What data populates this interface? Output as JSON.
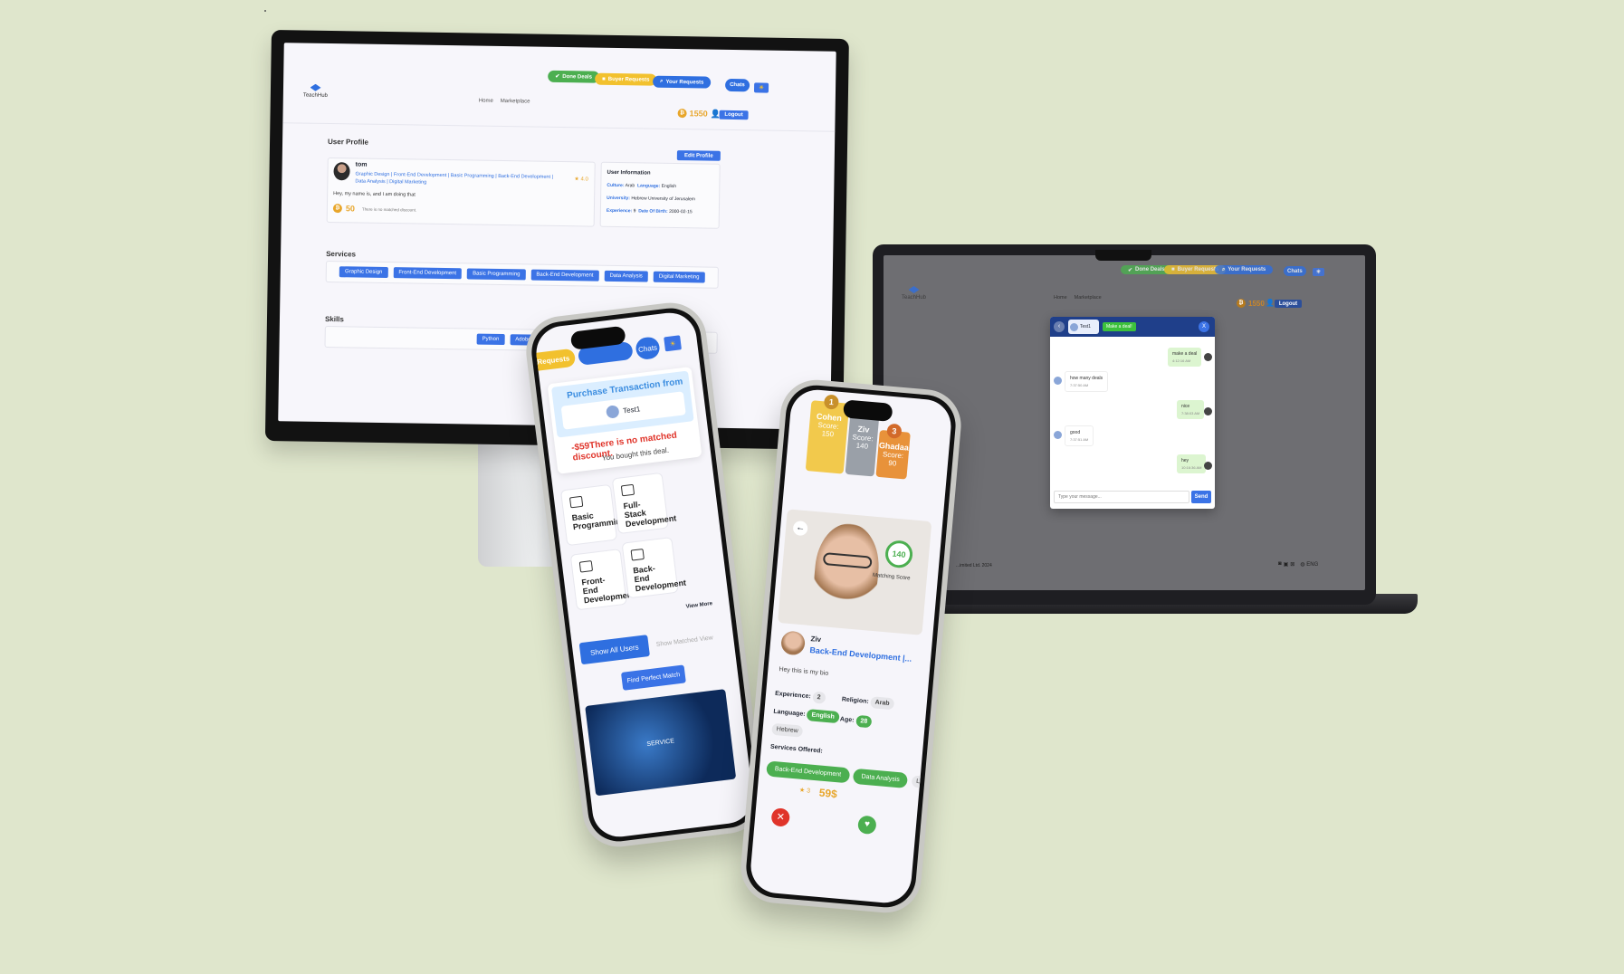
{
  "desktop": {
    "nav": {
      "done_deals": "Done Deals",
      "buyer_requests": "Buyer Requests",
      "your_requests": "Your Requests",
      "chats": "Chats",
      "logo_text": "TeachHub",
      "home": "Home",
      "marketplace": "Marketplace",
      "coins": "1550",
      "logout": "Logout"
    },
    "profile": {
      "section_title": "User Profile",
      "edit_button": "Edit Profile",
      "name": "tom",
      "services_line": "Graphic Design | Front-End Development | Basic Programming | Back-End Development | Data Analysis | Digital Marketing",
      "rating": "4.0",
      "bio": "Hey, my name is, and I am doing that",
      "price": "50",
      "discount_note": "There is no matched discount.",
      "info_title": "User Information",
      "culture_label": "Culture:",
      "culture": "Arab",
      "language_label": "Language:",
      "language": "English",
      "university_label": "University:",
      "university": "Hebrew University of Jerusalem",
      "experience_label": "Experience:",
      "experience": "9",
      "dob_label": "Date Of Birth:",
      "dob": "2000-02-15"
    },
    "services": {
      "title": "Services",
      "items": [
        "Graphic Design",
        "Front-End Development",
        "Basic Programming",
        "Back-End Development",
        "Data Analysis",
        "Digital Marketing"
      ]
    },
    "skills": {
      "title": "Skills",
      "items": [
        "Python",
        "Adobe XD",
        "A"
      ]
    }
  },
  "laptop": {
    "nav": {
      "done_deals": "Done Deals",
      "buyer_requests": "Buyer Requests",
      "your_requests": "Your Requests",
      "chats": "Chats",
      "logo_text": "TeachHub",
      "home": "Home",
      "marketplace": "Marketplace",
      "coins": "1550",
      "logout": "Logout"
    },
    "chat": {
      "contact": "Test1",
      "make_deal": "Make a deal!",
      "close": "X",
      "messages": [
        {
          "text": "make a deal",
          "time": "4:12:16 AM",
          "me": true
        },
        {
          "text": "how many deals",
          "time": "7:37:50 AM",
          "me": false
        },
        {
          "text": "nice",
          "time": "7:38:03 AM",
          "me": true
        },
        {
          "text": "good",
          "time": "7:37:51 AM",
          "me": false
        },
        {
          "text": "hey",
          "time": "10:16:36 AM",
          "me": true
        }
      ],
      "placeholder": "Type your message...",
      "send": "Send"
    },
    "footer": {
      "copyright": "...imited Ltd. 2024",
      "lang": "ENG"
    }
  },
  "phoneA": {
    "top": {
      "requests": "Requests",
      "chats": "Chats"
    },
    "transaction": {
      "title": "Purchase Transaction from",
      "user": "Test1",
      "price_line": "-$59There is no matched discount.",
      "bought": "You bought this deal."
    },
    "services": [
      {
        "label": "Basic Programming"
      },
      {
        "label": "Full-Stack Development"
      },
      {
        "label": "Front-End Development"
      },
      {
        "label": "Back-End Development"
      }
    ],
    "view_more": "View More",
    "tabs": {
      "show_all": "Show All Users",
      "show_matched": "Show Matched View"
    },
    "find_match": "Find Perfect Match",
    "banner_text": "SERVICE"
  },
  "phoneB": {
    "leaderboard": [
      {
        "rank": "1",
        "name": "Cohen",
        "score_label": "Score:",
        "score": "150",
        "color": "#f2c94c"
      },
      {
        "rank": "",
        "name": "Ziv",
        "score_label": "Score:",
        "score": "140",
        "color": "#9aa0a8"
      },
      {
        "rank": "3",
        "name": "Ghadaa",
        "score_label": "Score:",
        "score": "90",
        "color": "#e8923a"
      }
    ],
    "match": {
      "score": "140",
      "score_label": "Matching Score"
    },
    "profile": {
      "name": "Ziv",
      "title": "Back-End Development |...",
      "bio": "Hey this is my bio",
      "experience_label": "Experience:",
      "experience": "2",
      "religion_label": "Religion:",
      "religion": "Arab",
      "language_label": "Language:",
      "languages": [
        "English",
        "Hebrew"
      ],
      "age_label": "Age:",
      "age": "28",
      "services_label": "Services Offered:",
      "services": [
        "Back-End Development",
        "Data Analysis",
        "L"
      ],
      "rating": "3",
      "price": "59$"
    }
  }
}
